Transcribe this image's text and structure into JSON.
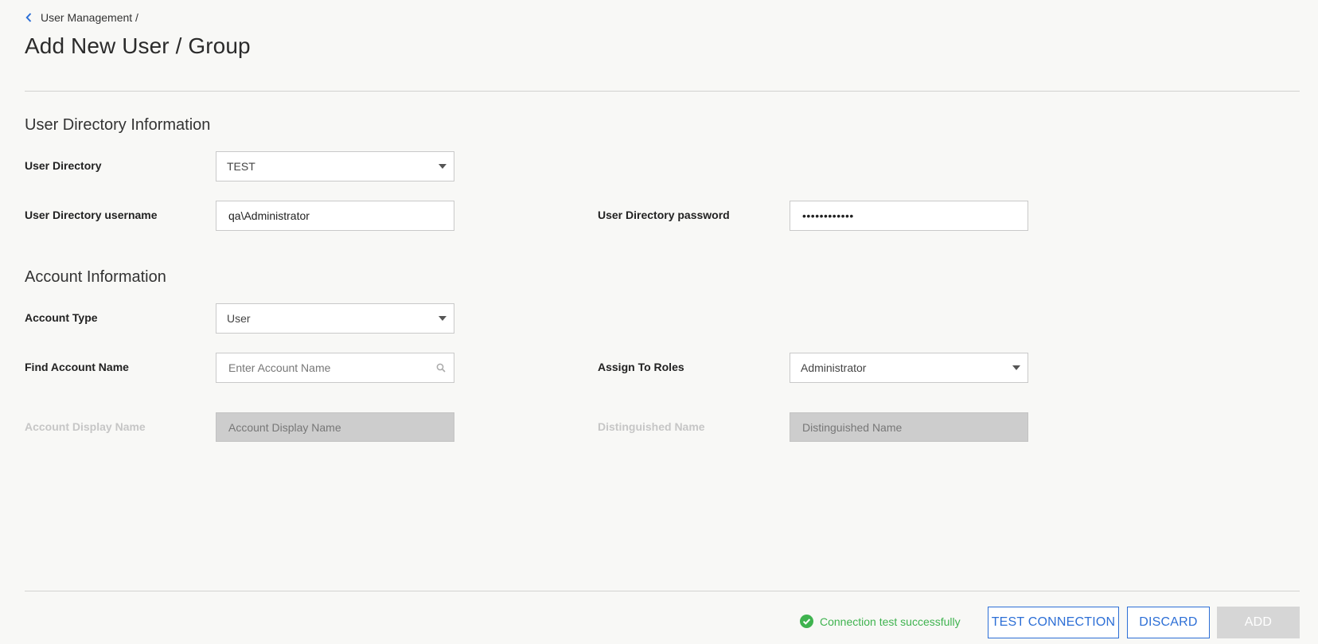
{
  "breadcrumb": {
    "parent": "User Management /"
  },
  "page_title": "Add New User / Group",
  "user_directory_section": {
    "title": "User Directory Information",
    "user_directory_label": "User Directory",
    "user_directory_value": "TEST",
    "username_label": "User Directory username",
    "username_value": "qa\\Administrator",
    "password_label": "User Directory password",
    "password_value": "••••••••••••"
  },
  "account_section": {
    "title": "Account Information",
    "account_type_label": "Account Type",
    "account_type_value": "User",
    "find_account_label": "Find Account Name",
    "find_account_placeholder": "Enter Account Name",
    "assign_roles_label": "Assign To Roles",
    "assign_roles_value": "Administrator",
    "display_name_label": "Account Display Name",
    "display_name_placeholder": "Account Display Name",
    "distinguished_name_label": "Distinguished Name",
    "distinguished_name_placeholder": "Distinguished Name"
  },
  "footer": {
    "status_text": "Connection test successfully",
    "test_connection_label": "TEST CONNECTION",
    "discard_label": "DISCARD",
    "add_label": "ADD"
  },
  "colors": {
    "accent": "#2d6fd6",
    "success": "#3fb34f",
    "disabled_field": "#cdcdcd",
    "background": "#f8f8f6"
  },
  "icons": [
    "chevron-left-icon",
    "caret-down-icon",
    "search-icon",
    "check-circle-icon"
  ]
}
